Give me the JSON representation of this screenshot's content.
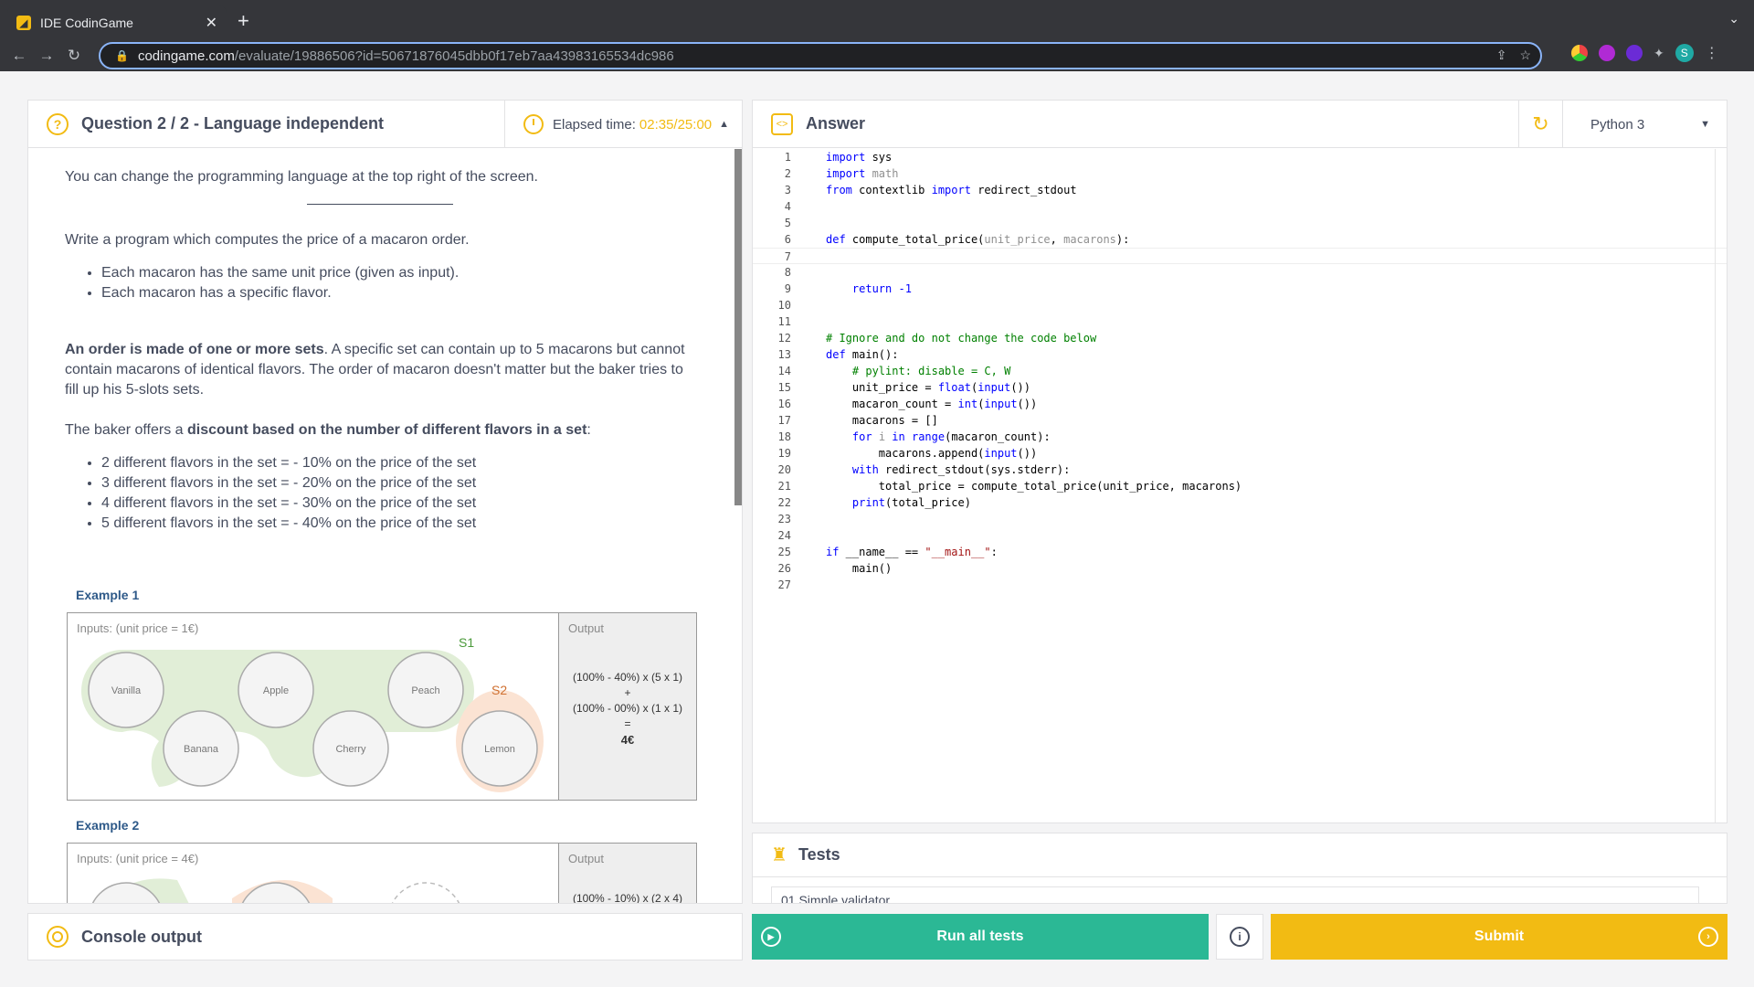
{
  "browser": {
    "tab_title": "IDE CodinGame",
    "url_domain": "codingame.com",
    "url_path": "/evaluate/19886506?id=50671876045dbb0f17eb7aa43983165534dc986",
    "profile_initial": "S"
  },
  "question": {
    "title": "Question 2 / 2 - Language independent",
    "elapsed_label": "Elapsed time:",
    "elapsed_value": "02:35/25:00",
    "intro": "You can change the programming language at the top right of the screen.",
    "task": "Write a program which computes the price of a macaron order.",
    "bullets1": [
      "Each macaron has the same unit price (given as input).",
      "Each macaron has a specific flavor."
    ],
    "order_bold": "An order is made of one or more sets",
    "order_rest": ". A specific set can contain up to 5 macarons but cannot contain macarons of identical flavors. The order of macaron doesn't matter but the baker tries to fill up his 5-slots sets.",
    "discount_pre": "The baker offers a ",
    "discount_bold": "discount based on the number of different flavors in a set",
    "discount_post": ":",
    "discounts": [
      "2 different flavors in the set = - 10% on the price of the set",
      "3 different flavors in the set = - 20% on the price of the set",
      "4 different flavors in the set = - 30% on the price of the set",
      "5 different flavors in the set = - 40% on the price of the set"
    ],
    "example1": {
      "title": "Example 1",
      "inputs_label": "Inputs: (unit price = 1€)",
      "output_label": "Output",
      "set1_label": "S1",
      "set2_label": "S2",
      "flavors": [
        "Vanilla",
        "Apple",
        "Peach",
        "Banana",
        "Cherry",
        "Lemon"
      ],
      "out_line1": "(100% - 40%) x (5 x 1)",
      "out_plus": "+",
      "out_line2": "(100% - 00%) x (1 x 1)",
      "out_eq": "=",
      "out_result": "4€"
    },
    "example2": {
      "title": "Example 2",
      "inputs_label": "Inputs: (unit price = 4€)",
      "output_label": "Output",
      "out_line1": "(100% - 10%) x (2 x 4)"
    }
  },
  "answer": {
    "title": "Answer",
    "language": "Python 3",
    "code": [
      [
        [
          "kw",
          "import"
        ],
        [
          "t",
          " sys"
        ]
      ],
      [
        [
          "kw",
          "import"
        ],
        [
          "pm",
          " math"
        ]
      ],
      [
        [
          "kw",
          "from"
        ],
        [
          "t",
          " contextlib "
        ],
        [
          "kw",
          "import"
        ],
        [
          "t",
          " redirect_stdout"
        ]
      ],
      [],
      [],
      [
        [
          "kw",
          "def"
        ],
        [
          "t",
          " compute_total_price("
        ],
        [
          "pm",
          "unit_price"
        ],
        [
          "t",
          ", "
        ],
        [
          "pm",
          "macarons"
        ],
        [
          "t",
          "):"
        ]
      ],
      [],
      [],
      [
        [
          "t",
          "    "
        ],
        [
          "kw",
          "return"
        ],
        [
          "t",
          " "
        ],
        [
          "kw",
          "-1"
        ]
      ],
      [],
      [],
      [
        [
          "cm",
          "# Ignore and do not change the code below"
        ]
      ],
      [
        [
          "kw",
          "def"
        ],
        [
          "t",
          " main():"
        ]
      ],
      [
        [
          "cm",
          "    # pylint: disable = C, W"
        ]
      ],
      [
        [
          "t",
          "    unit_price = "
        ],
        [
          "bi",
          "float"
        ],
        [
          "t",
          "("
        ],
        [
          "bi",
          "input"
        ],
        [
          "t",
          "())"
        ]
      ],
      [
        [
          "t",
          "    macaron_count = "
        ],
        [
          "bi",
          "int"
        ],
        [
          "t",
          "("
        ],
        [
          "bi",
          "input"
        ],
        [
          "t",
          "())"
        ]
      ],
      [
        [
          "t",
          "    macarons = []"
        ]
      ],
      [
        [
          "t",
          "    "
        ],
        [
          "kw",
          "for"
        ],
        [
          "pm",
          " i"
        ],
        [
          "t",
          " "
        ],
        [
          "kw",
          "in"
        ],
        [
          "t",
          " "
        ],
        [
          "bi",
          "range"
        ],
        [
          "t",
          "(macaron_count):"
        ]
      ],
      [
        [
          "t",
          "        macarons.append("
        ],
        [
          "bi",
          "input"
        ],
        [
          "t",
          "())"
        ]
      ],
      [
        [
          "t",
          "    "
        ],
        [
          "kw",
          "with"
        ],
        [
          "t",
          " redirect_stdout(sys.stderr):"
        ]
      ],
      [
        [
          "t",
          "        total_price = compute_total_price(unit_price, macarons)"
        ]
      ],
      [
        [
          "t",
          "    "
        ],
        [
          "bi",
          "print"
        ],
        [
          "t",
          "(total_price)"
        ]
      ],
      [],
      [],
      [
        [
          "kw",
          "if"
        ],
        [
          "t",
          " __name__ == "
        ],
        [
          "st",
          "\"__main__\""
        ],
        [
          "t",
          ":"
        ]
      ],
      [
        [
          "t",
          "    main()"
        ]
      ],
      []
    ]
  },
  "tests": {
    "title": "Tests",
    "first_item": "01   Simple validator"
  },
  "console": {
    "title": "Console output"
  },
  "actions": {
    "run_label": "Run all tests",
    "submit_label": "Submit"
  },
  "colors": {
    "accent": "#f2bb13",
    "run": "#2bb895",
    "heading": "#454c5e"
  }
}
